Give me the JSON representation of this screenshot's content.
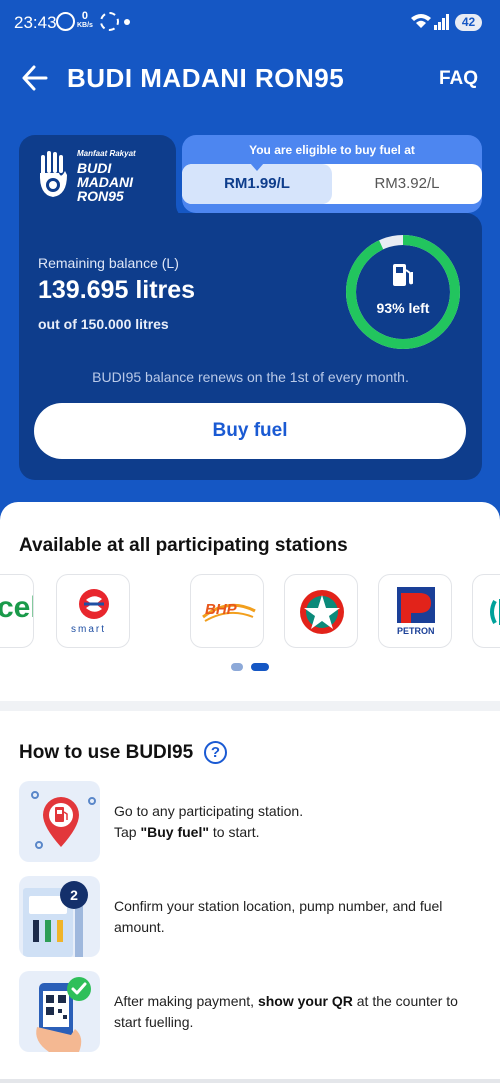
{
  "status_bar": {
    "time": "23:43",
    "net_speed": "0",
    "net_unit": "KB/s",
    "battery": "42",
    "wifi_label": "6"
  },
  "header": {
    "title": "BUDI MADANI RON95",
    "faq": "FAQ"
  },
  "logo": {
    "tagline": "Manfaat Rakyat",
    "line1": "BUDI",
    "line2": "MADANI",
    "line3": "RON95"
  },
  "price": {
    "caption": "You are eligible to buy fuel at",
    "options": [
      {
        "label": "RM1.99/L",
        "selected": true
      },
      {
        "label": "RM3.92/L",
        "selected": false
      }
    ]
  },
  "balance": {
    "label": "Remaining balance (L)",
    "value": "139.695 litres",
    "total": "out of 150.000 litres",
    "percent_text": "93% left",
    "percent_left": 0.93,
    "renew_note": "BUDI95 balance renews on the 1st of every month.",
    "buy_button": "Buy fuel"
  },
  "stations": {
    "title": "Available at all participating stations",
    "logos": [
      {
        "name": "caltex-partial",
        "text": "cel"
      },
      {
        "name": "smart",
        "text": "smart"
      },
      {
        "name": "bhp",
        "text": "BHP"
      },
      {
        "name": "caltex",
        "text": ""
      },
      {
        "name": "petron",
        "text": "PETRON"
      },
      {
        "name": "petronas-partial",
        "text": ""
      }
    ],
    "pager_count": 2,
    "pager_active": 1
  },
  "how_to": {
    "title": "How to use BUDI95",
    "steps": [
      {
        "line1": "Go to any participating station.",
        "pre": "Tap ",
        "bold": "\"Buy fuel\"",
        "post": " to start."
      },
      {
        "text": "Confirm your station location, pump number, and fuel amount.",
        "badge": "2"
      },
      {
        "pre": "After making payment, ",
        "bold": "show your QR",
        "post": " at the counter to start fuelling."
      }
    ]
  },
  "colors": {
    "primary": "#1557c4",
    "card": "#0e3d8c",
    "ring": "#22c55e",
    "accent_blue": "#1a5ad3"
  }
}
